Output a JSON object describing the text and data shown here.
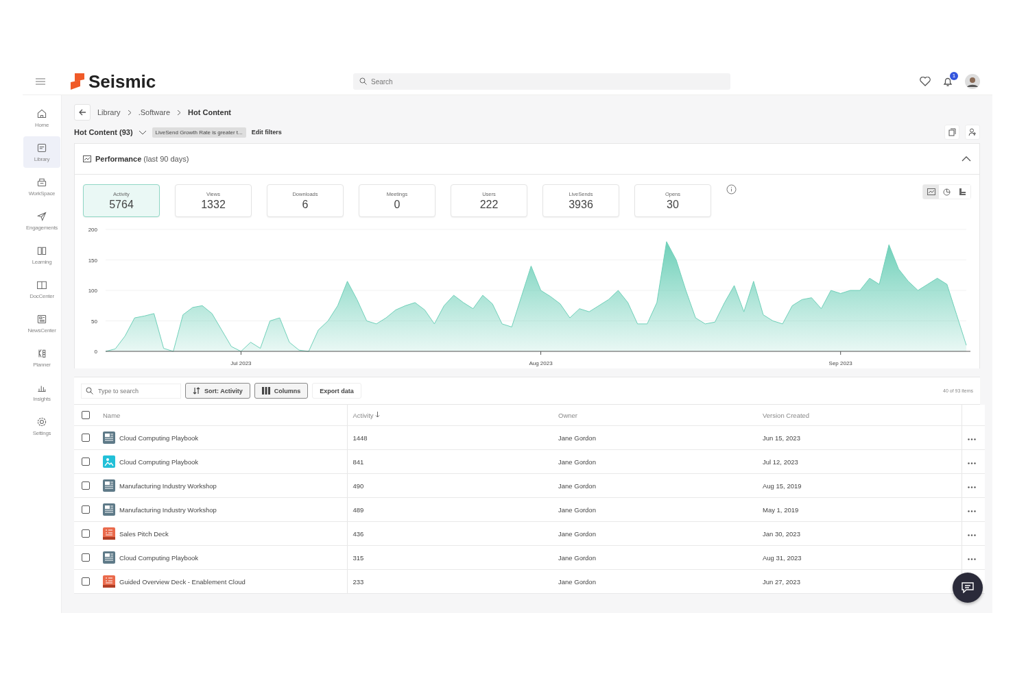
{
  "header": {
    "logo": "Seismic",
    "search": {
      "placeholder": "Search"
    },
    "notification_count": "1"
  },
  "sidebar": {
    "items": [
      {
        "label": "Home",
        "selected": false
      },
      {
        "label": "Library",
        "selected": true
      },
      {
        "label": "WorkSpace",
        "selected": false
      },
      {
        "label": "Engagements",
        "selected": false
      },
      {
        "label": "Learning",
        "selected": false
      },
      {
        "label": "DocCenter",
        "selected": false
      },
      {
        "label": "NewsCenter",
        "selected": false
      },
      {
        "label": "Planner",
        "selected": false
      },
      {
        "label": "Insights",
        "selected": false
      },
      {
        "label": "Settings",
        "selected": false
      }
    ]
  },
  "breadcrumb": [
    "Library",
    ".Software",
    "Hot Content"
  ],
  "view": {
    "title": "Hot Content (93)",
    "filter": "LiveSend Growth Rate is greater t...",
    "edit_filters": "Edit filters"
  },
  "performance": {
    "title": "Performance",
    "subtitle": "(last 90 days)",
    "metrics": [
      {
        "label": "Activity",
        "value": "5764",
        "selected": true
      },
      {
        "label": "Views",
        "value": "1332",
        "selected": false
      },
      {
        "label": "Downloads",
        "value": "6",
        "selected": false
      },
      {
        "label": "Meetings",
        "value": "0",
        "selected": false
      },
      {
        "label": "Users",
        "value": "222",
        "selected": false
      },
      {
        "label": "LiveSends",
        "value": "3936",
        "selected": false
      },
      {
        "label": "Opens",
        "value": "30",
        "selected": false
      }
    ],
    "chart_views": [
      {
        "kind": "area",
        "selected": true
      },
      {
        "kind": "pie",
        "selected": false
      },
      {
        "kind": "bars",
        "selected": false
      }
    ],
    "chart_data": {
      "type": "area",
      "grid": true,
      "categories": [
        null,
        null,
        null,
        null,
        null,
        null,
        null,
        null,
        null,
        null,
        null,
        null,
        null,
        null,
        "Jul 2023",
        null,
        null,
        null,
        null,
        null,
        null,
        null,
        null,
        null,
        null,
        null,
        null,
        null,
        null,
        null,
        null,
        null,
        null,
        null,
        null,
        null,
        null,
        null,
        null,
        null,
        null,
        null,
        null,
        null,
        null,
        "Aug 2023",
        null,
        null,
        null,
        null,
        null,
        null,
        null,
        null,
        null,
        null,
        null,
        null,
        null,
        null,
        null,
        null,
        null,
        null,
        null,
        null,
        null,
        null,
        null,
        null,
        null,
        null,
        null,
        null,
        null,
        null,
        "Sep 2023",
        null,
        null,
        null,
        null,
        null,
        null,
        null,
        null,
        null,
        null,
        null,
        null,
        null
      ],
      "ylim": [
        0,
        200
      ],
      "yticks": [
        0,
        50,
        100,
        150,
        200
      ],
      "series": [
        {
          "color": "#6fd0b9",
          "values": [
            0,
            4,
            25,
            55,
            58,
            62,
            5,
            0,
            60,
            72,
            75,
            62,
            35,
            8,
            0,
            15,
            5,
            50,
            55,
            15,
            2,
            0,
            35,
            50,
            75,
            115,
            85,
            50,
            45,
            55,
            68,
            75,
            80,
            68,
            45,
            75,
            92,
            80,
            70,
            92,
            78,
            45,
            40,
            90,
            140,
            100,
            90,
            78,
            55,
            70,
            65,
            75,
            85,
            100,
            80,
            45,
            45,
            80,
            180,
            150,
            100,
            55,
            45,
            48,
            80,
            108,
            65,
            115,
            60,
            50,
            45,
            75,
            85,
            88,
            70,
            100,
            95,
            100,
            100,
            120,
            110,
            175,
            135,
            115,
            100,
            110,
            120,
            110,
            60,
            10
          ]
        }
      ]
    }
  },
  "table": {
    "select_all_checked": false,
    "search_placeholder": "Type to search",
    "sort_button": "Sort: Activity",
    "columns_button": "Columns",
    "export_button": "Export data",
    "count": "40 of 93 items",
    "columns": [
      "Name",
      "Activity",
      "Owner",
      "Version Created"
    ],
    "rows": [
      {
        "kind": "doc",
        "checked": false,
        "name": "Cloud Computing Playbook",
        "activity": "1448",
        "owner": "Jane Gordon",
        "created": "Jun 15, 2023"
      },
      {
        "kind": "image",
        "checked": false,
        "name": "Cloud Computing Playbook",
        "activity": "841",
        "owner": "Jane Gordon",
        "created": "Jul 12, 2023"
      },
      {
        "kind": "doc",
        "checked": false,
        "name": "Manufacturing Industry Workshop",
        "activity": "490",
        "owner": "Jane Gordon",
        "created": "Aug 15, 2019"
      },
      {
        "kind": "doc",
        "checked": false,
        "name": "Manufacturing Industry Workshop",
        "activity": "489",
        "owner": "Jane Gordon",
        "created": "May 1, 2019"
      },
      {
        "kind": "deck",
        "checked": false,
        "name": "Sales Pitch Deck",
        "activity": "436",
        "owner": "Jane Gordon",
        "created": "Jan 30, 2023"
      },
      {
        "kind": "doc",
        "checked": false,
        "name": "Cloud Computing Playbook",
        "activity": "315",
        "owner": "Jane Gordon",
        "created": "Aug 31, 2023"
      },
      {
        "kind": "deck",
        "checked": false,
        "name": "Guided Overview Deck - Enablement Cloud",
        "activity": "233",
        "owner": "Jane Gordon",
        "created": "Jun 27, 2023"
      }
    ]
  }
}
